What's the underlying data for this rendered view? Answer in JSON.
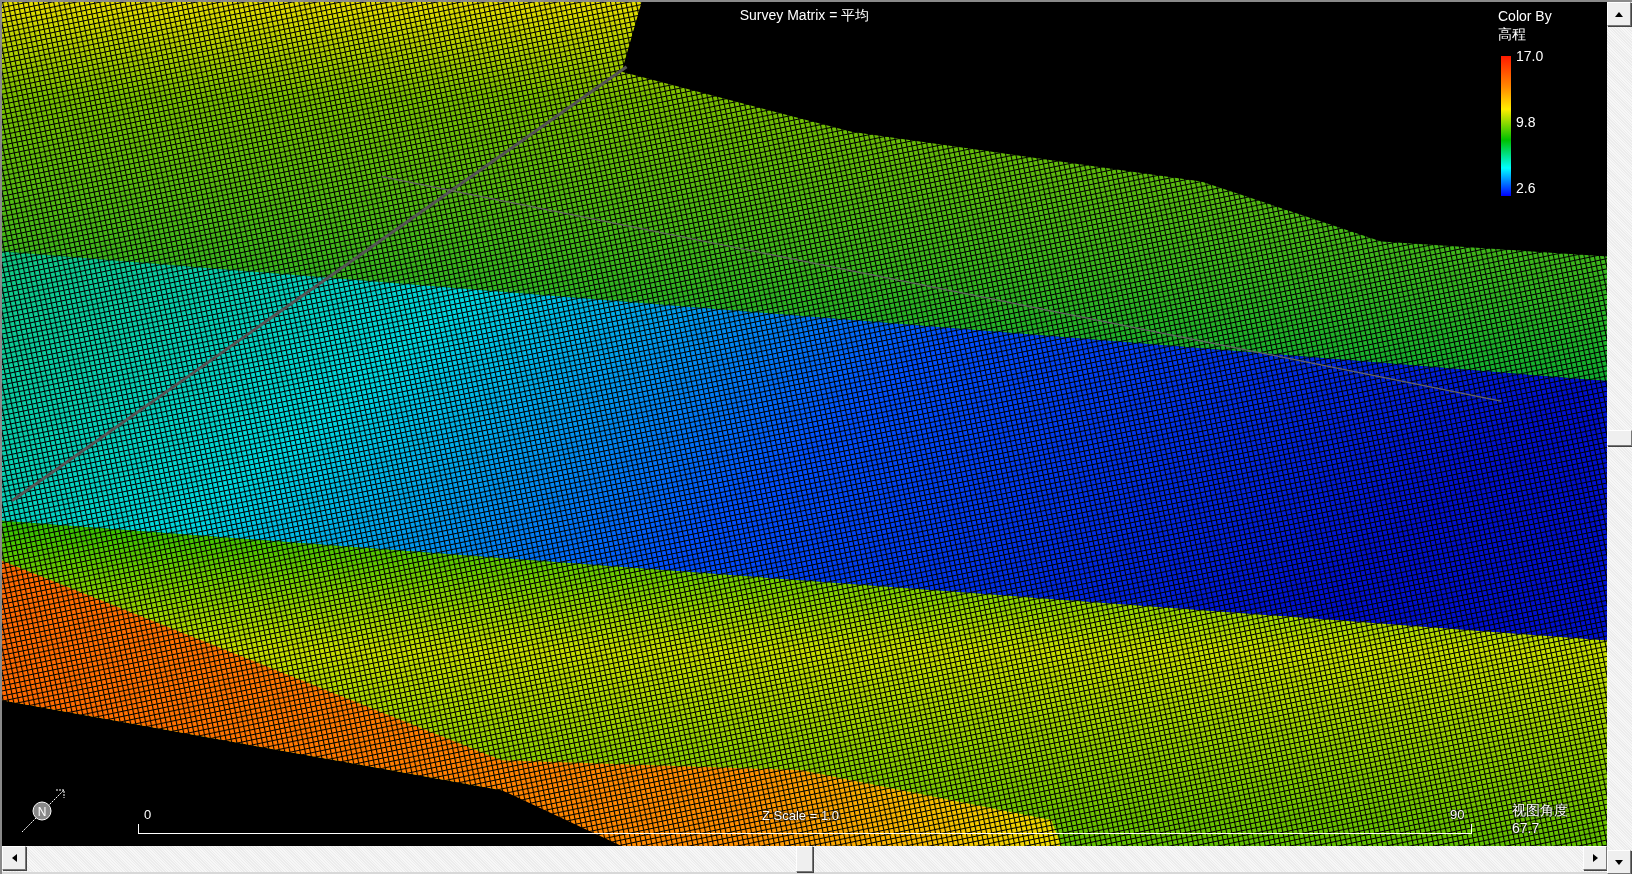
{
  "title": "Survey Matrix = 平均",
  "legend": {
    "label": "Color By",
    "field": "高程",
    "ticks": [
      "17.0",
      "9.8",
      "2.6"
    ]
  },
  "compass": {
    "label": "N"
  },
  "scale_bar": {
    "start": "0",
    "end": "90",
    "caption": "Z Scale = 1.0"
  },
  "view_angle": {
    "label": "视图角度",
    "value": "67.7"
  }
}
